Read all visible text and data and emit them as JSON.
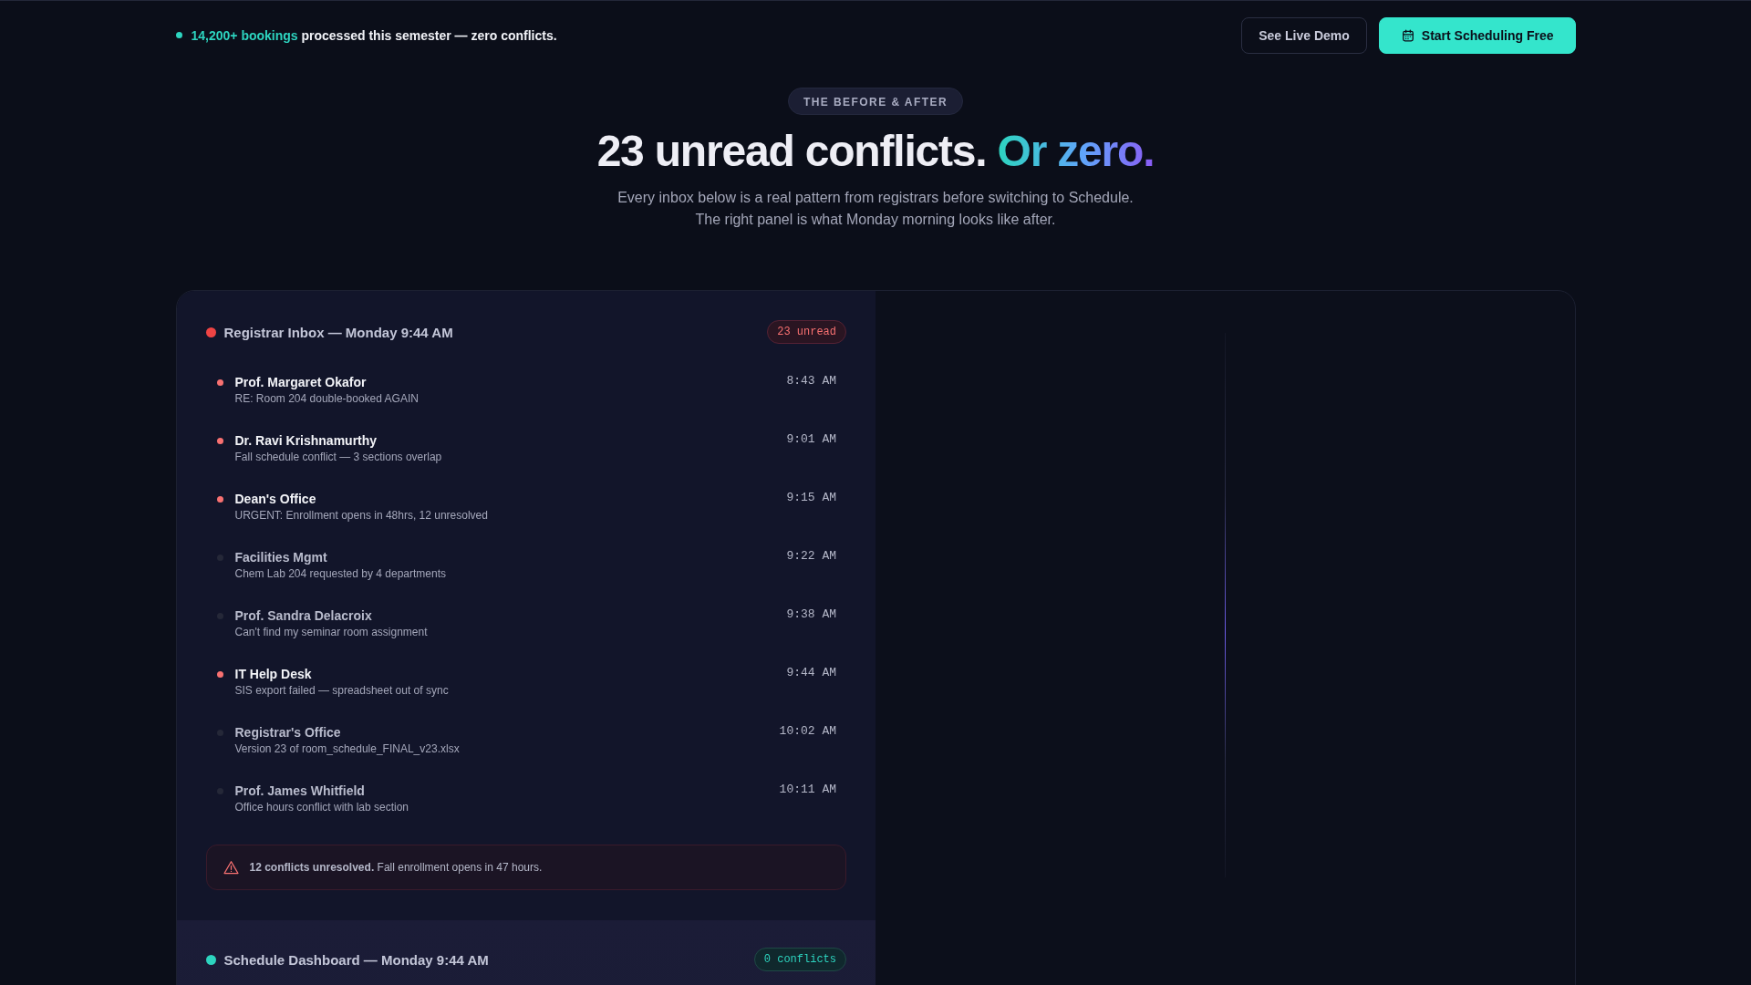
{
  "announcement": {
    "highlight": "14,200+ bookings",
    "text": "processed this semester — zero conflicts."
  },
  "actions": [
    {
      "label": "See Live Demo",
      "kind": "secondary"
    },
    {
      "label": "Start Scheduling Free",
      "kind": "primary"
    }
  ],
  "hero": {
    "eyebrow": "THE BEFORE & AFTER",
    "headline": "23 unread conflicts.",
    "headline_accent": "Or zero.",
    "subtitle": "Every inbox below is a real pattern from registrars before switching to Schedule.\nThe right panel is what Monday morning looks like after."
  },
  "panels": [
    {
      "kind": "inbox",
      "title": "Registrar Inbox — Monday 9:44 AM",
      "color": "#ef4444",
      "badge": "23 unread",
      "messages": [
        {
          "sender": "Prof. Margaret Okafor",
          "subject": "RE: Room 204 double-booked AGAIN",
          "time": "8:43 AM",
          "unread": true
        },
        {
          "sender": "Dr. Ravi Krishnamurthy",
          "subject": "Fall schedule conflict — 3 sections overlap",
          "time": "9:01 AM",
          "unread": true
        },
        {
          "sender": "Dean's Office",
          "subject": "URGENT: Enrollment opens in 48hrs, 12 unresolved",
          "time": "9:15 AM",
          "unread": true
        },
        {
          "sender": "Facilities Mgmt",
          "subject": "Chem Lab 204 requested by 4 departments",
          "time": "9:22 AM",
          "unread": false
        },
        {
          "sender": "Prof. Sandra Delacroix",
          "subject": "Can't find my seminar room assignment",
          "time": "9:38 AM",
          "unread": false
        },
        {
          "sender": "IT Help Desk",
          "subject": "SIS export failed — spreadsheet out of sync",
          "time": "9:44 AM",
          "unread": true
        },
        {
          "sender": "Registrar's Office",
          "subject": "Version 23 of room_schedule_FINAL_v23.xlsx",
          "time": "10:02 AM",
          "unread": false
        },
        {
          "sender": "Prof. James Whitfield",
          "subject": "Office hours conflict with lab section",
          "time": "10:11 AM",
          "unread": false
        }
      ],
      "alert": "**12 conflicts unresolved.** Fall enrollment opens in 47 hours."
    },
    {
      "kind": "dashboard",
      "title": "Schedule Dashboard — Monday 9:44 AM",
      "color": "#2dd4bf",
      "badge": "0 conflicts"
    }
  ]
}
